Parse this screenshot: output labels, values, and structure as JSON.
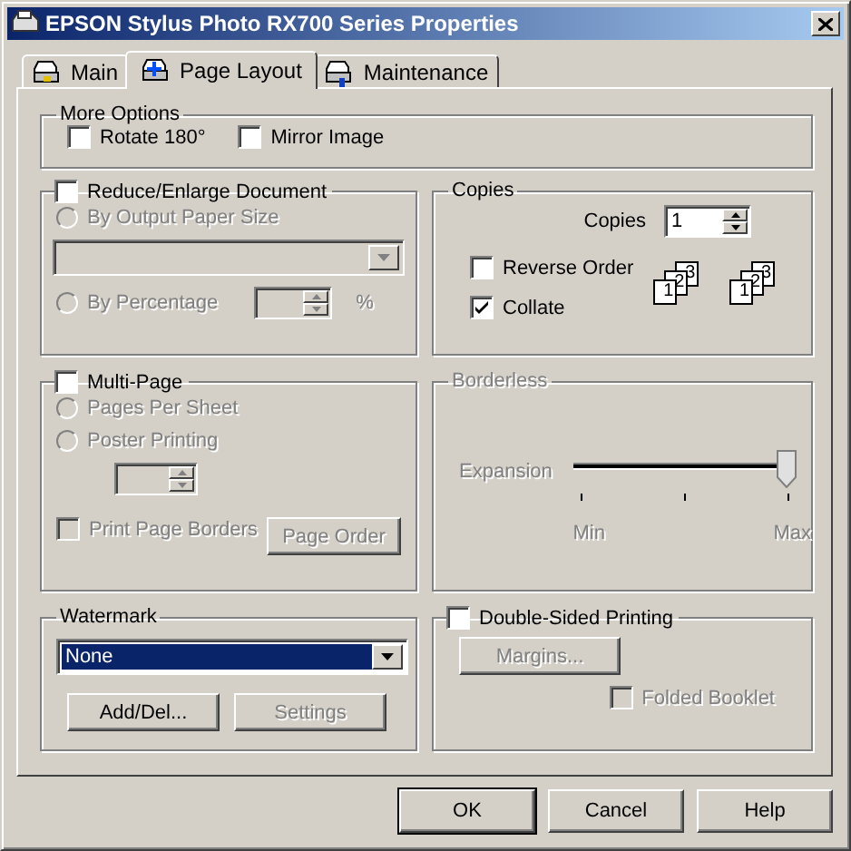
{
  "window": {
    "title": "EPSON Stylus Photo RX700 Series Properties"
  },
  "tabs": [
    {
      "label": "Main",
      "selected": false
    },
    {
      "label": "Page Layout",
      "selected": true
    },
    {
      "label": "Maintenance",
      "selected": false
    }
  ],
  "more_options": {
    "title": "More Options",
    "options": [
      {
        "label": "Rotate 180°",
        "checked": false
      },
      {
        "label": "Mirror Image",
        "checked": false
      }
    ]
  },
  "reduce_enlarge": {
    "label": "Reduce/Enlarge Document",
    "checked": false,
    "modes": [
      {
        "label": "By Output Paper Size",
        "selected": false,
        "disabled": true
      },
      {
        "label": "By Percentage",
        "selected": false,
        "disabled": true
      }
    ],
    "paper_size_dropdown": {
      "disabled": true
    },
    "percentage_field": {
      "disabled": true
    },
    "unit": "%"
  },
  "multi_page": {
    "label": "Multi-Page",
    "checked": false,
    "modes": [
      {
        "label": "Pages Per Sheet",
        "selected": false,
        "disabled": true
      },
      {
        "label": "Poster Printing",
        "selected": false,
        "disabled": true
      }
    ],
    "poster_field": {
      "disabled": true
    },
    "print_page_borders": {
      "label": "Print Page Borders",
      "checked": false,
      "disabled": true
    },
    "page_order_button": {
      "label": "Page Order",
      "disabled": true
    }
  },
  "watermark": {
    "title": "Watermark",
    "selection": "None",
    "buttons": [
      {
        "label": "Add/Del...",
        "disabled": false
      },
      {
        "label": "Settings",
        "disabled": true
      }
    ]
  },
  "copies": {
    "title": "Copies",
    "copies_label": "Copies",
    "copies_value": "1",
    "options": [
      {
        "label": "Reverse Order",
        "checked": false
      },
      {
        "label": "Collate",
        "checked": true
      }
    ],
    "page_stacks": [
      {
        "pages": [
          "1",
          "2",
          "3"
        ]
      },
      {
        "pages": [
          "1",
          "2",
          "3"
        ]
      }
    ]
  },
  "borderless": {
    "title": "Borderless",
    "disabled": true,
    "expansion_label": "Expansion",
    "slider": {
      "level": 1
    },
    "tick_labels": [
      "Min",
      "Max"
    ]
  },
  "double_sided": {
    "label": "Double-Sided Printing",
    "checked": false,
    "margins_button": {
      "label": "Margins...",
      "disabled": true
    },
    "folded_booklet": {
      "label": "Folded Booklet",
      "checked": false,
      "disabled": true
    }
  },
  "dialog_buttons": [
    {
      "label": "OK",
      "default": true
    },
    {
      "label": "Cancel",
      "default": false
    },
    {
      "label": "Help",
      "default": false
    }
  ]
}
